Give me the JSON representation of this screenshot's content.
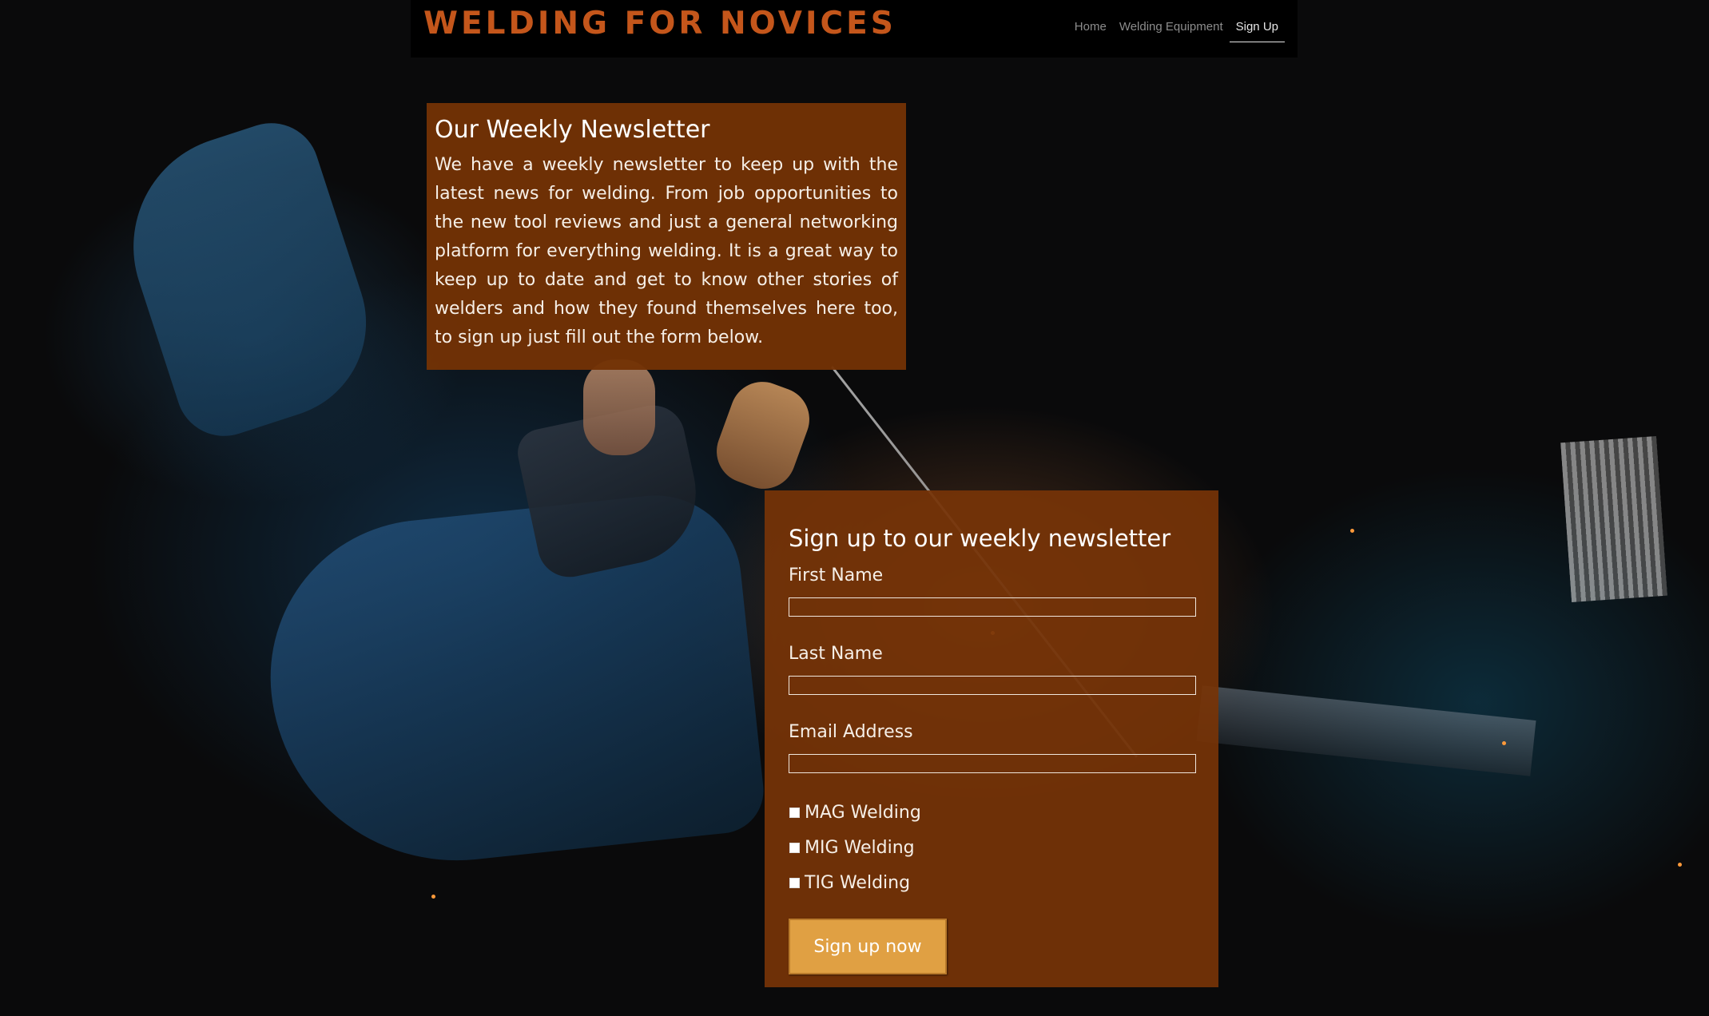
{
  "site": {
    "brand": "WELDING FOR NOVICES"
  },
  "nav": {
    "items": [
      {
        "label": "Home",
        "active": false
      },
      {
        "label": "Welding Equipment",
        "active": false
      },
      {
        "label": "Sign Up",
        "active": true
      }
    ]
  },
  "newsletter_info": {
    "heading": "Our Weekly Newsletter",
    "body": "We have a weekly newsletter to keep up with the latest news for welding. From job opportunities to the new tool reviews and just a general networking platform for everything welding. It is a great way to keep up to date and get to know other stories of welders and how they found themselves here too, to sign up just fill out the form below."
  },
  "signup_form": {
    "heading": "Sign up to our weekly newsletter",
    "fields": [
      {
        "label": "First Name",
        "value": ""
      },
      {
        "label": "Last Name",
        "value": ""
      },
      {
        "label": "Email Address",
        "value": ""
      }
    ],
    "options": [
      {
        "label": "MAG Welding",
        "checked": false
      },
      {
        "label": "MIG Welding",
        "checked": false
      },
      {
        "label": "TIG Welding",
        "checked": false
      }
    ],
    "submit_label": "Sign up now"
  },
  "colors": {
    "brand": "#c4561b",
    "panel": "#733205",
    "button": "#e0a043",
    "navbar": "#000000"
  }
}
